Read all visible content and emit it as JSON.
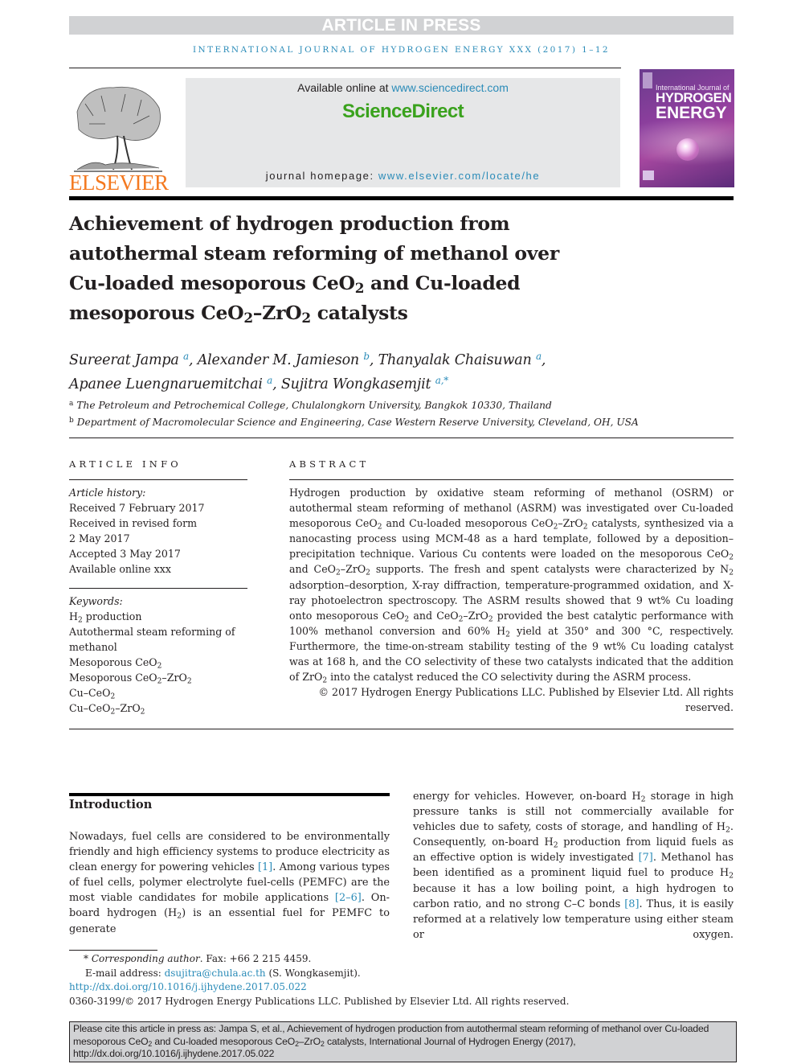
{
  "banner": "ARTICLE IN PRESS",
  "journal_line": "INTERNATIONAL JOURNAL OF HYDROGEN ENERGY XXX (2017) 1–12",
  "masthead": {
    "publisher_logo_text": "ELSEVIER",
    "available_prefix": "Available online at ",
    "available_link": "www.sciencedirect.com",
    "sciencedirect_logo": "ScienceDirect",
    "homepage_prefix": "journal homepage: ",
    "homepage_link": "www.elsevier.com/locate/he",
    "cover": {
      "line1": "International Journal of",
      "line2": "HYDROGEN",
      "line3": "ENERGY"
    },
    "colors": {
      "elsevier_orange": "#f47920",
      "sciencedirect_green": "#3aa21d",
      "link_blue": "#2a8bb8",
      "banner_gray": "#d1d2d4",
      "masthead_gray": "#e6e7e8"
    }
  },
  "title": {
    "line1": "Achievement of hydrogen production from",
    "line2": "autothermal steam reforming of methanol over",
    "line3a": "Cu-loaded mesoporous CeO",
    "line3b": " and Cu-loaded",
    "line4a": "mesoporous CeO",
    "line4b": "–ZrO",
    "line4c": " catalysts",
    "sub": "2"
  },
  "authors": [
    {
      "name": "Sureerat Jampa",
      "aff": "a",
      "sep": ", "
    },
    {
      "name": "Alexander M. Jamieson",
      "aff": "b",
      "sep": ", "
    },
    {
      "name": "Thanyalak Chaisuwan",
      "aff": "a",
      "sep": ","
    },
    {
      "name": "Apanee Luengnaruemitchai",
      "aff": "a",
      "sep": ", "
    },
    {
      "name": "Sujitra Wongkasemjit",
      "aff": "a,*",
      "sep": ""
    }
  ],
  "affiliations": [
    {
      "mark": "a",
      "text": "The Petroleum and Petrochemical College, Chulalongkorn University, Bangkok 10330, Thailand"
    },
    {
      "mark": "b",
      "text": "Department of Macromolecular Science and Engineering, Case Western Reserve University, Cleveland, OH, USA"
    }
  ],
  "article_info": {
    "heading": "ARTICLE INFO",
    "history_label": "Article history:",
    "history": [
      "Received 7 February 2017",
      "Received in revised form",
      "2 May 2017",
      "Accepted 3 May 2017",
      "Available online xxx"
    ],
    "keywords_label": "Keywords:",
    "keywords": [
      {
        "a": "H",
        "sub": "2",
        "b": " production"
      },
      {
        "a": "Autothermal steam reforming of",
        "sub": "",
        "b": ""
      },
      {
        "a": "methanol",
        "sub": "",
        "b": ""
      },
      {
        "a": "Mesoporous CeO",
        "sub": "2",
        "b": ""
      },
      {
        "a": "Mesoporous CeO",
        "sub": "2",
        "b": "–ZrO",
        "sub2": "2"
      },
      {
        "a": "Cu–CeO",
        "sub": "2",
        "b": ""
      },
      {
        "a": "Cu–CeO",
        "sub": "2",
        "b": "–ZrO",
        "sub2": "2"
      }
    ]
  },
  "abstract": {
    "heading": "ABSTRACT",
    "p1": "Hydrogen production by oxidative steam reforming of methanol (OSRM) or autothermal steam reforming of methanol (ASRM) was investigated over Cu-loaded mesoporous CeO",
    "p2": " and Cu-loaded mesoporous CeO",
    "p3": "–ZrO",
    "p4": " catalysts, synthesized via a nanocasting process using MCM-48 as a hard template, followed by a deposition–precipitation technique. Various Cu contents were loaded on the mesoporous CeO",
    "p5": " and CeO",
    "p6": "–ZrO",
    "p7": " supports. The fresh and spent catalysts were characterized by N",
    "p8": " adsorption–desorption, X-ray diffraction, temperature-programmed oxidation, and X-ray photoelectron spectroscopy. The ASRM results showed that 9 wt% Cu loading onto mesoporous CeO",
    "p9": " and CeO",
    "p10": "–ZrO",
    "p11": " provided the best catalytic performance with 100% methanol conversion and 60% H",
    "p12": " yield at 350° and 300 °C, respectively. Furthermore, the time-on-stream stability testing of the 9 wt% Cu loading catalyst was at 168 h, and the CO selectivity of these two catalysts indicated that the addition of ZrO",
    "p13": " into the catalyst reduced the CO selectivity during the ASRM process.",
    "copyright": "© 2017 Hydrogen Energy Publications LLC. Published by Elsevier Ltd. All rights reserved."
  },
  "introduction": {
    "heading": "Introduction",
    "left_a": "Nowadays, fuel cells are considered to be environmentally friendly and high efficiency systems to produce electricity as clean energy for powering vehicles ",
    "ref1": "[1]",
    "left_b": ". Among various types of fuel cells, polymer electrolyte fuel-cells (PEMFC) are the most viable candidates for mobile applications ",
    "ref2": "[2–6]",
    "left_c": ". On-board hydrogen (H",
    "left_d": ") is an essential fuel for PEMFC to generate",
    "right_a": "energy for vehicles. However, on-board H",
    "right_b": " storage in high pressure tanks is still not commercially available for vehicles due to safety, costs of storage, and handling of H",
    "right_c": ". Consequently, on-board H",
    "right_d": " production from liquid fuels as an effective option is widely investigated ",
    "ref3": "[7]",
    "right_e": ". Methanol has been identified as a prominent liquid fuel to produce H",
    "right_f": " because it has a low boiling point, a high hydrogen to carbon ratio, and no strong C–C bonds ",
    "ref4": "[8]",
    "right_g": ". Thus, it is easily reformed at a relatively low temperature using either steam or oxygen.",
    "sub": "2"
  },
  "footnotes": {
    "star": "*",
    "corresponding_label": "Corresponding author",
    "fax": ". Fax: +66 2 215 4459.",
    "email_label": "E-mail address: ",
    "email": "dsujitra@chula.ac.th",
    "email_name": " (S. Wongkasemjit).",
    "doi": "http://dx.doi.org/10.1016/j.ijhydene.2017.05.022",
    "issn_copyright": "0360-3199/© 2017 Hydrogen Energy Publications LLC. Published by Elsevier Ltd. All rights reserved."
  },
  "cite_box": {
    "a": "Please cite this article in press as: Jampa S, et al., Achievement of hydrogen production from autothermal steam reforming of methanol over Cu-loaded mesoporous CeO",
    "b": " and Cu-loaded mesoporous CeO",
    "c": "–ZrO",
    "d": " catalysts, International Journal of Hydrogen Energy (2017), http://dx.doi.org/10.1016/j.ijhydene.2017.05.022",
    "sub": "2"
  }
}
